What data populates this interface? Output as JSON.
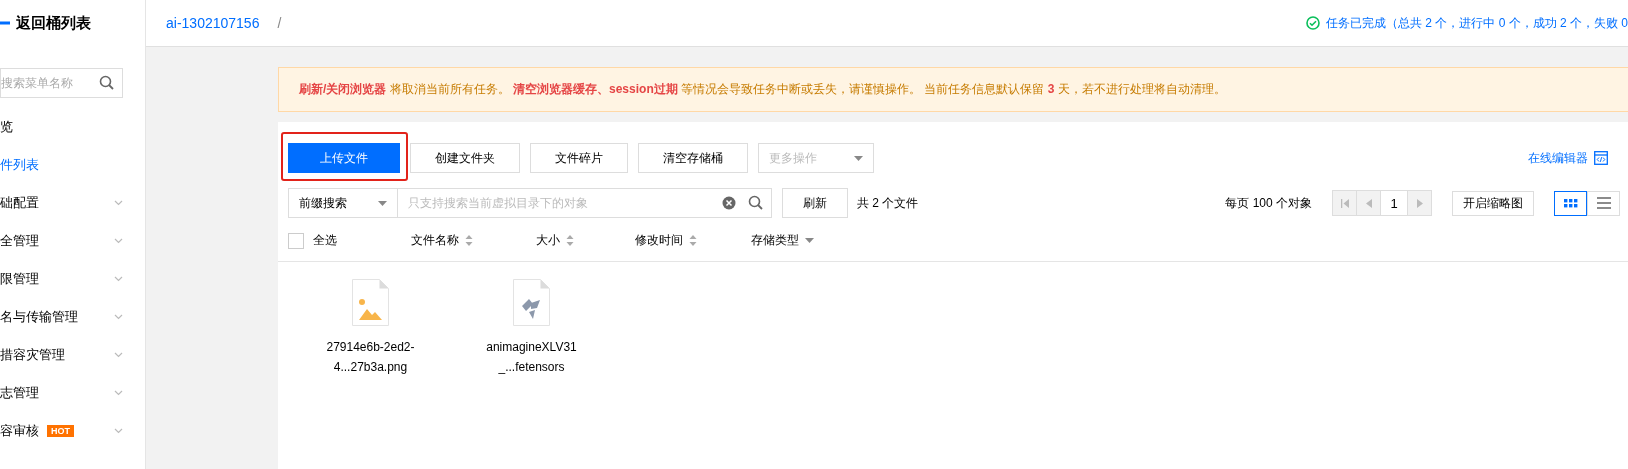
{
  "sidebar": {
    "back_label": "返回桶列表",
    "search": {
      "placeholder": "搜索菜单名称"
    },
    "items": [
      {
        "label": "览",
        "selected": false,
        "expandable": false
      },
      {
        "label": "件列表",
        "selected": true,
        "expandable": false
      },
      {
        "label": "础配置",
        "selected": false,
        "expandable": true
      },
      {
        "label": "全管理",
        "selected": false,
        "expandable": true
      },
      {
        "label": "限管理",
        "selected": false,
        "expandable": true
      },
      {
        "label": "名与传输管理",
        "selected": false,
        "expandable": true
      },
      {
        "label": "措容灾管理",
        "selected": false,
        "expandable": true
      },
      {
        "label": "志管理",
        "selected": false,
        "expandable": true
      },
      {
        "label": "容审核",
        "selected": false,
        "expandable": true,
        "badge": "HOT"
      }
    ]
  },
  "header": {
    "breadcrumb": [
      {
        "label": "ai-1302107156",
        "kind": "link"
      },
      {
        "label": "/",
        "kind": "separator"
      }
    ],
    "task_status": "任务已完成（总共 2 个，进行中 0 个，成功 2 个，失败 0"
  },
  "notice": [
    {
      "text": "刷新/关闭浏览器",
      "kind": "strong"
    },
    {
      "text": " 将取消当前所有任务。 ",
      "kind": "plain"
    },
    {
      "text": "清空浏览器缓存、session过期",
      "kind": "strong"
    },
    {
      "text": " 等情况会导致任务中断或丢失，请谨慎操作。 当前任务信息默认保留 ",
      "kind": "plain"
    },
    {
      "text": "3",
      "kind": "strong"
    },
    {
      "text": " 天，若不进行处理将自动清理。",
      "kind": "plain"
    }
  ],
  "toolbar": {
    "buttons": [
      {
        "label": "上传文件",
        "kind": "primary",
        "highlighted": true
      },
      {
        "label": "创建文件夹",
        "kind": "default"
      },
      {
        "label": "文件碎片",
        "kind": "default"
      },
      {
        "label": "清空存储桶",
        "kind": "default"
      }
    ],
    "more_dropdown": {
      "label": "更多操作",
      "disabled": true
    },
    "editor_link": "在线编辑器"
  },
  "search_row": {
    "mode": "前缀搜索",
    "search": {
      "placeholder": "只支持搜索当前虚拟目录下的对象"
    },
    "refresh": "刷新",
    "count": "共 2 个文件",
    "per_page": "每页 100 个对象",
    "page": "1",
    "thumbnail_button": "开启缩略图",
    "views": [
      {
        "kind": "grid",
        "selected": true
      },
      {
        "kind": "list",
        "selected": false
      }
    ]
  },
  "list_header": {
    "select_all": {
      "label": "全选",
      "checked": false
    },
    "columns": [
      {
        "label": "文件名称",
        "kind": "sortable"
      },
      {
        "label": "大小",
        "kind": "sortable"
      },
      {
        "label": "修改时间",
        "kind": "sortable"
      },
      {
        "label": "存储类型",
        "kind": "filter"
      }
    ]
  },
  "files": [
    {
      "name_lines": [
        "27914e6b-2ed2-",
        "4...27b3a.png"
      ],
      "kind": "image"
    },
    {
      "name_lines": [
        "animagineXLV31",
        "_...fetensors"
      ],
      "kind": "model"
    }
  ]
}
